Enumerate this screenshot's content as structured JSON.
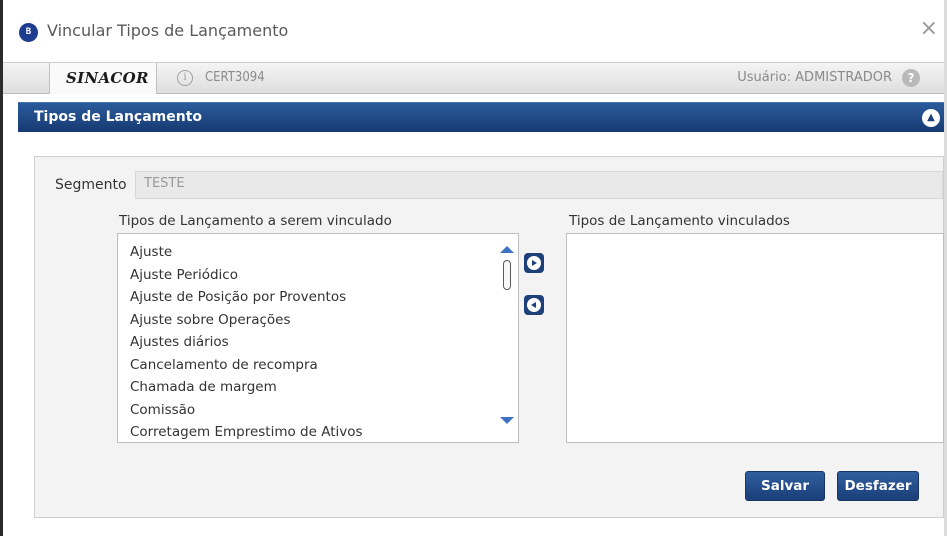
{
  "window": {
    "app_icon_text": "B",
    "title": "Vincular Tipos de Lançamento",
    "close_symbol": "×"
  },
  "infobar": {
    "brand": "SINACOR",
    "info_symbol": "i",
    "server": "CERT3094",
    "user": "Usuário: ADMISTRADOR",
    "help_symbol": "?"
  },
  "panel": {
    "title": "Tipos de Lançamento",
    "collapse_symbol": "▲"
  },
  "form": {
    "segmento_label": "Segmento",
    "segmento_value": "TESTE",
    "available_label": "Tipos de Lançamento a serem vinculado",
    "available_items": [
      "Ajuste",
      "Ajuste Periódico",
      "Ajuste de Posição por Proventos",
      "Ajuste sobre Operações",
      "Ajustes diários",
      "Cancelamento de recompra",
      "Chamada de margem",
      "Comissão",
      "Corretagem Emprestimo de Ativos"
    ],
    "linked_label": "Tipos de Lançamento vinculados",
    "linked_items": []
  },
  "buttons": {
    "save": "Salvar",
    "undo": "Desfazer"
  },
  "icons": {
    "app": "app-logo-icon",
    "close": "close-icon",
    "info": "info-icon",
    "help": "help-icon",
    "collapse": "collapse-icon",
    "add": "arrow-right-icon",
    "remove": "arrow-left-icon"
  },
  "colors": {
    "header_blue": "#1d3f7a",
    "scroll_arrow": "#3e73c4"
  }
}
